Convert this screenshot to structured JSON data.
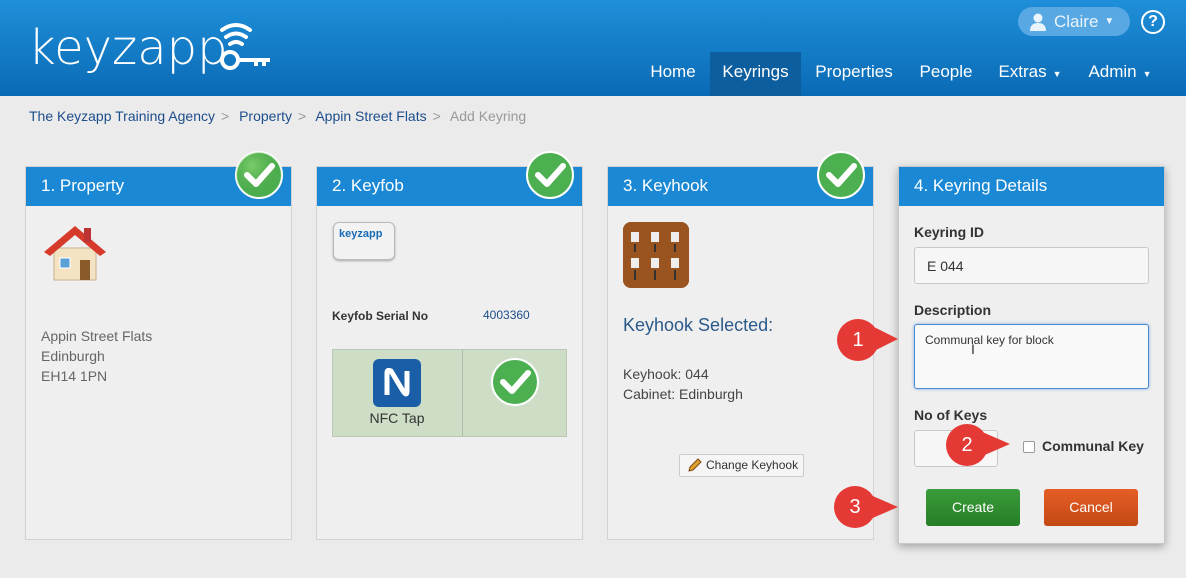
{
  "app": {
    "logo": "keyzapp"
  },
  "user": {
    "name": "Claire",
    "help": "?"
  },
  "nav": [
    "Home",
    "Keyrings",
    "Properties",
    "People",
    "Extras",
    "Admin"
  ],
  "breadcrumb": [
    "The Keyzapp Training Agency",
    "Property",
    "Appin Street Flats",
    "Add Keyring"
  ],
  "property": {
    "title": "1. Property",
    "address": [
      "Appin Street Flats",
      "Edinburgh",
      "EH14 1PN"
    ]
  },
  "keyfob": {
    "title": "2. Keyfob",
    "serial_label": "Keyfob Serial No",
    "serial": "4003360",
    "nfc_label": "NFC Tap",
    "fob_brand": "keyzapp"
  },
  "keyhook": {
    "title": "3. Keyhook",
    "selected": "Keyhook Selected:",
    "keyhook_line": "Keyhook: 044",
    "cabinet_line": "Cabinet: Edinburgh",
    "change_button": "Change Keyhook"
  },
  "details": {
    "title": "4. Keyring Details",
    "id_label": "Keyring ID",
    "id_value": "E 044",
    "desc_label": "Description",
    "desc_value": "Communal key for block",
    "keys_label": "No of Keys",
    "keys_value": "",
    "communal_label": "Communal Key",
    "communal_checked": false,
    "create": "Create",
    "cancel": "Cancel"
  },
  "callouts": [
    "1",
    "2",
    "3"
  ],
  "colors": {
    "header": "#1a88d4",
    "active_nav": "#0d5e9e",
    "create": "#2e8b2e",
    "cancel": "#d9531e",
    "badge": "#e53935"
  }
}
